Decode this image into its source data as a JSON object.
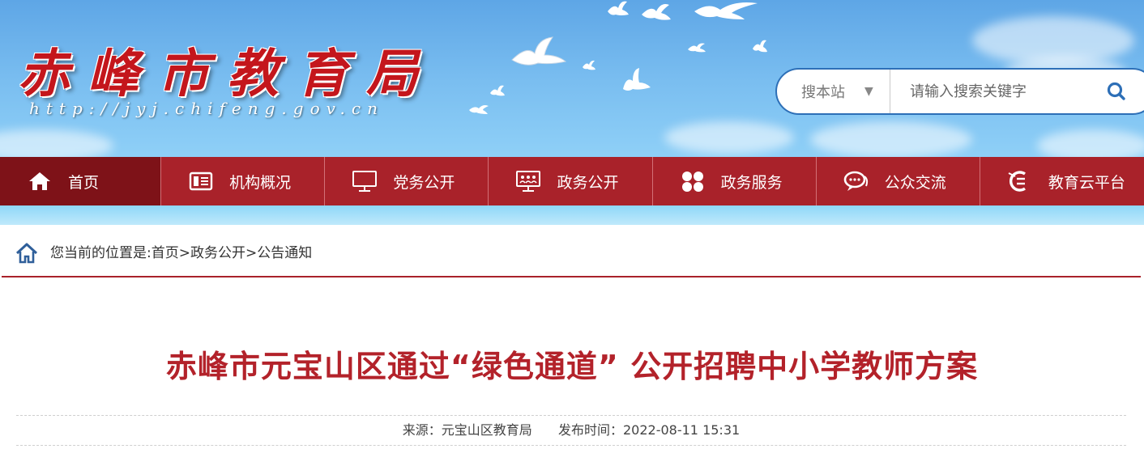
{
  "header": {
    "site_title": "赤峰市教育局",
    "site_url": "http://jyj.chifeng.gov.cn"
  },
  "search": {
    "scope_label": "搜本站",
    "placeholder": "请输入搜索关键字"
  },
  "nav": {
    "items": [
      {
        "label": "首页",
        "icon": "home-icon"
      },
      {
        "label": "机构概况",
        "icon": "organization-icon"
      },
      {
        "label": "党务公开",
        "icon": "monitor-icon"
      },
      {
        "label": "政务公开",
        "icon": "presentation-icon"
      },
      {
        "label": "政务服务",
        "icon": "grid-icon"
      },
      {
        "label": "公众交流",
        "icon": "chat-icon"
      },
      {
        "label": "教育云平台",
        "icon": "education-cloud-icon"
      }
    ]
  },
  "breadcrumb": {
    "prefix": "您当前的位置是:",
    "path": "首页>政务公开>公告通知"
  },
  "article": {
    "title": "赤峰市元宝山区通过“绿色通道” 公开招聘中小学教师方案",
    "source_label": "来源：元宝山区教育局",
    "date_label": "发布时间：2022-08-11 15:31"
  },
  "colors": {
    "nav_bg": "#a9222a",
    "nav_active": "#7e1218",
    "title_red": "#b3222a",
    "search_border": "#2d6fb7"
  }
}
